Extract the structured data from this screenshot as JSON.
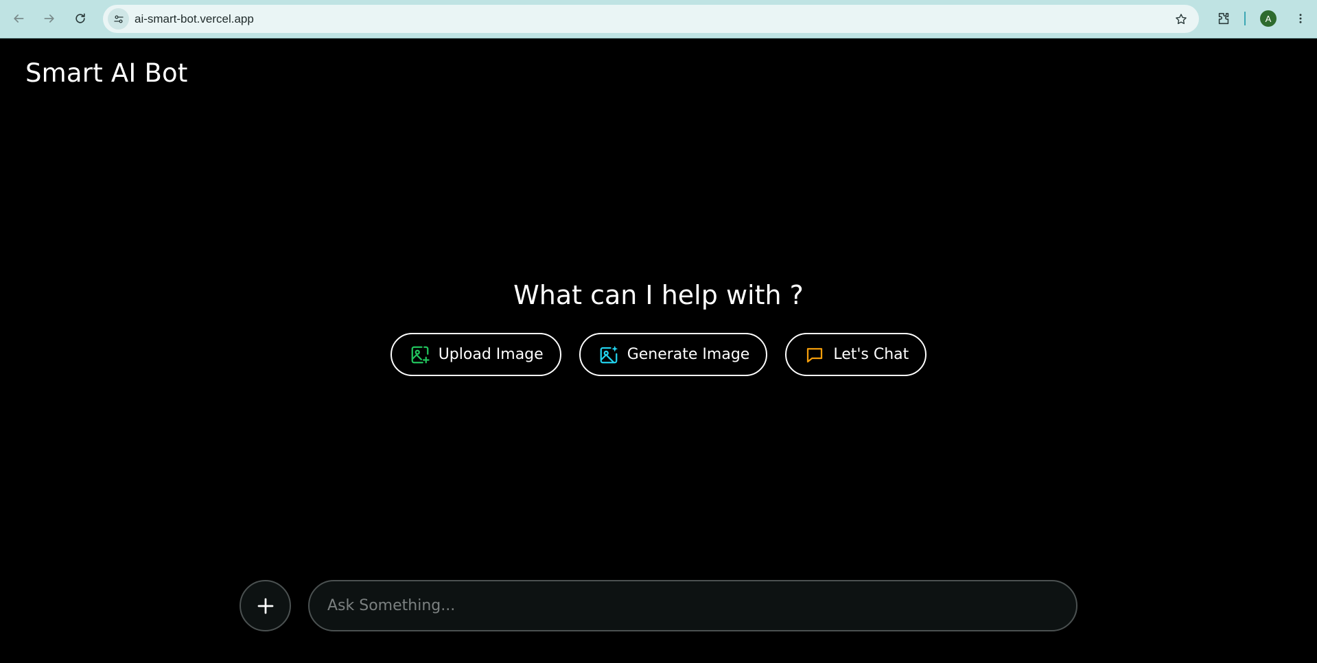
{
  "browser": {
    "url": "ai-smart-bot.vercel.app",
    "profile_initial": "A",
    "icons": [
      "back-icon",
      "forward-icon",
      "reload-icon",
      "site-info-icon",
      "bookmark-star-icon",
      "extensions-icon",
      "more-menu-icon"
    ]
  },
  "app": {
    "brand": "Smart AI Bot",
    "heading": "What can I help with ?",
    "actions": [
      {
        "label": "Upload Image",
        "icon": "image-plus-icon",
        "color": "#22c55e"
      },
      {
        "label": "Generate Image",
        "icon": "image-sparkle-icon",
        "color": "#22d3ee"
      },
      {
        "label": "Let's Chat",
        "icon": "chat-bubble-icon",
        "color": "#f59e0b"
      }
    ],
    "composer": {
      "plus_icon": "plus-icon",
      "placeholder": "Ask Something..."
    }
  },
  "colors": {
    "background": "#000000",
    "chrome": "#bfe3e3",
    "input_bg": "#0d1212",
    "input_border": "#4b5151"
  }
}
